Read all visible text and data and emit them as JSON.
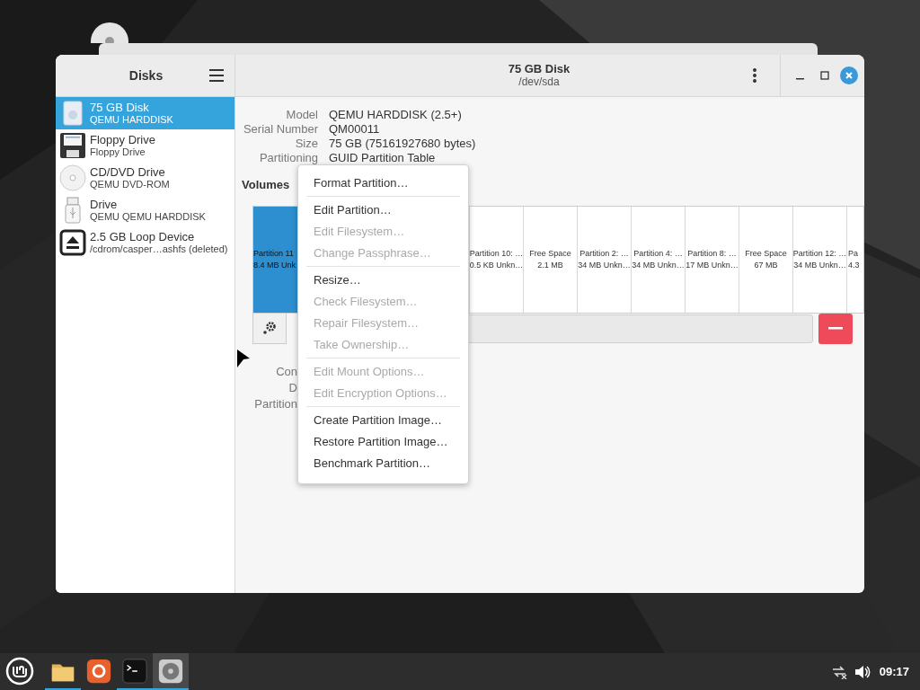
{
  "window": {
    "sidebar_title": "Disks",
    "title": "75 GB Disk",
    "subtitle": "/dev/sda"
  },
  "drives": [
    {
      "name": "75 GB Disk",
      "detail": "QEMU HARDDISK",
      "kind": "hdd",
      "selected": true
    },
    {
      "name": "Floppy Drive",
      "detail": "Floppy Drive",
      "kind": "floppy",
      "selected": false
    },
    {
      "name": "CD/DVD Drive",
      "detail": "QEMU DVD-ROM",
      "kind": "optical",
      "selected": false
    },
    {
      "name": "Drive",
      "detail": "QEMU QEMU HARDDISK",
      "kind": "usb",
      "selected": false
    },
    {
      "name": "2.5 GB Loop Device",
      "detail": "/cdrom/casper…ashfs (deleted)",
      "kind": "loop",
      "selected": false
    }
  ],
  "details": [
    {
      "label": "Model",
      "value": "QEMU HARDDISK (2.5+)"
    },
    {
      "label": "Serial Number",
      "value": "QM00011"
    },
    {
      "label": "Size",
      "value": "75 GB (75161927680 bytes)"
    },
    {
      "label": "Partitioning",
      "value": "GUID Partition Table"
    }
  ],
  "volumes_label": "Volumes",
  "segments": [
    {
      "line1": "Partition 11",
      "line2": "8.4 MB Unk",
      "selected": true
    },
    {
      "line1": "Partition 10: …",
      "line2": "0.5 KB Unkn…",
      "selected": false
    },
    {
      "line1": "Free Space",
      "line2": "2.1 MB",
      "selected": false
    },
    {
      "line1": "Partition 2: …",
      "line2": "34 MB Unkn…",
      "selected": false
    },
    {
      "line1": "Partition 4: …",
      "line2": "34 MB Unkn…",
      "selected": false
    },
    {
      "line1": "Partition 8: …",
      "line2": "17 MB Unkn…",
      "selected": false
    },
    {
      "line1": "Free Space",
      "line2": "67 MB",
      "selected": false
    },
    {
      "line1": "Partition 12: …",
      "line2": "34 MB Unkn…",
      "selected": false
    },
    {
      "line1": "Pa",
      "line2": "4.3",
      "selected": false
    }
  ],
  "lower_labels": [
    "Con",
    "D",
    "Partition"
  ],
  "menu": [
    {
      "label": "Format Partition…",
      "disabled": false,
      "separator_before": false
    },
    {
      "label": "Edit Partition…",
      "disabled": false,
      "separator_before": true
    },
    {
      "label": "Edit Filesystem…",
      "disabled": true,
      "separator_before": false
    },
    {
      "label": "Change Passphrase…",
      "disabled": true,
      "separator_before": false
    },
    {
      "label": "Resize…",
      "disabled": false,
      "separator_before": true
    },
    {
      "label": "Check Filesystem…",
      "disabled": true,
      "separator_before": false
    },
    {
      "label": "Repair Filesystem…",
      "disabled": true,
      "separator_before": false
    },
    {
      "label": "Take Ownership…",
      "disabled": true,
      "separator_before": false
    },
    {
      "label": "Edit Mount Options…",
      "disabled": true,
      "separator_before": true
    },
    {
      "label": "Edit Encryption Options…",
      "disabled": true,
      "separator_before": false
    },
    {
      "label": "Create Partition Image…",
      "disabled": false,
      "separator_before": true
    },
    {
      "label": "Restore Partition Image…",
      "disabled": false,
      "separator_before": false
    },
    {
      "label": "Benchmark Partition…",
      "disabled": false,
      "separator_before": false
    }
  ],
  "taskbar": {
    "apps": [
      {
        "kind": "folder",
        "running": true,
        "selected": false
      },
      {
        "kind": "browser",
        "running": false,
        "selected": false
      },
      {
        "kind": "terminal",
        "running": true,
        "selected": false
      },
      {
        "kind": "disks",
        "running": true,
        "selected": true
      }
    ],
    "clock": "09:17"
  }
}
